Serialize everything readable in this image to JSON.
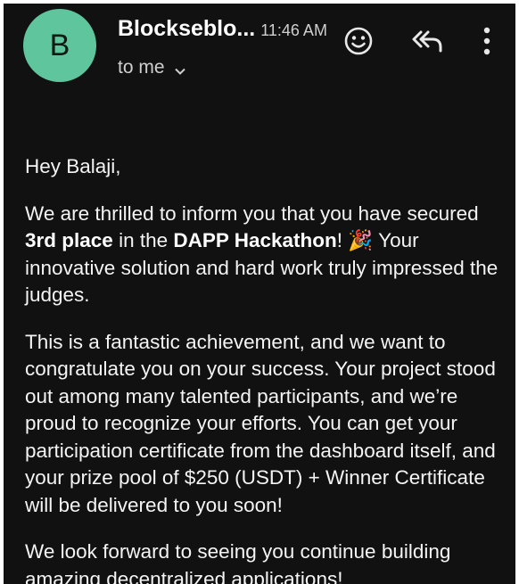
{
  "header": {
    "avatar_letter": "B",
    "sender": "Blockseblo...",
    "time": "11:46 AM",
    "recipient": "to me",
    "icons": {
      "avatar": "avatar",
      "chevron": "chevron-down-icon",
      "emoji": "smiley-face-icon",
      "reply": "reply-all-icon",
      "more": "more-vertical-icon"
    }
  },
  "email": {
    "greeting": "Hey Balaji,",
    "p1": {
      "part1": "We are thrilled to inform you that you have secured ",
      "place": "3rd place",
      "part2": " in the ",
      "event": "DAPP Hackathon",
      "part3": "! ",
      "emoji": "🎉",
      "part4": " Your innovative solution and hard work truly impressed the judges."
    },
    "p2": "This is a fantastic achievement, and we want to congratulate you on your success. Your project stood out among many talented participants, and we’re proud to recognize your efforts. You can get your participation certificate from the dashboard itself, and your prize pool of $250 (USDT) + Winner Certificate will be delivered to you soon!",
    "p3": "We look forward to seeing you continue building amazing decentralized applications!"
  },
  "colors": {
    "background": "#111111",
    "avatar": "#5ec59d",
    "text": "#f4f4f4"
  }
}
